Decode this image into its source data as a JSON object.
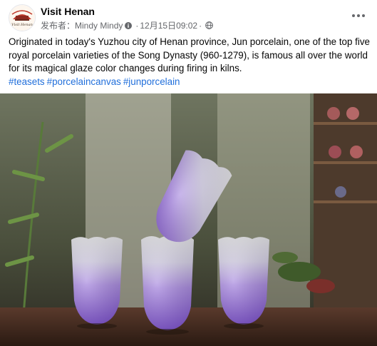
{
  "page": {
    "name": "Visit Henan",
    "avatar_text": "Visit Henan",
    "publisher_label": "发布者：",
    "publisher_name": "Mindy Mindy",
    "timestamp": "12月15日09:02",
    "separator": "·"
  },
  "post": {
    "text": "Originated in today's Yuzhou city of Henan province, Jun porcelain, one of the top five royal porcelain varieties of the Song Dynasty (960-1279), is famous all over the world for its magical glaze color changes during firing in kilns.",
    "hashtags": [
      "#teasets",
      "#porcelaincanvas",
      "#junporcelain"
    ]
  },
  "icons": {
    "more": "more-horizontal-icon",
    "info": "info-icon",
    "globe": "globe-icon"
  },
  "colors": {
    "hashtag": "#216fdb",
    "meta": "#65676b",
    "glaze_purple": "#8b5bd6"
  }
}
